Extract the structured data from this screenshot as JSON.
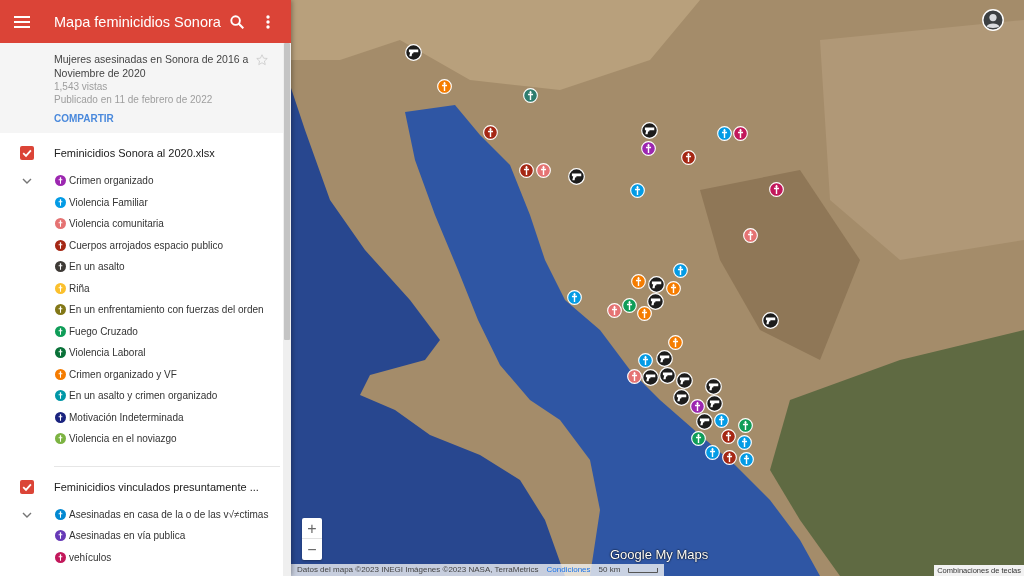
{
  "app_bar": {
    "title": "Mapa feminicidios Sonora"
  },
  "map_info": {
    "description": "Mujeres asesinadas en Sonora de 2016 a Noviembre de 2020",
    "views": "1,543 vistas",
    "published": "Publicado en 11 de febrero de 2022",
    "share_label": "COMPARTIR",
    "starred": false
  },
  "layers": [
    {
      "title": "Feminicidios Sonora al 2020.xlsx",
      "checked": true,
      "expanded": true,
      "items": [
        {
          "label": "Crimen organizado",
          "color": "#9c27b0"
        },
        {
          "label": "Violencia Familiar",
          "color": "#039be5"
        },
        {
          "label": "Violencia comunitaria",
          "color": "#e57373"
        },
        {
          "label": "Cuerpos arrojados espacio publico",
          "color": "#a52714"
        },
        {
          "label": "En un asalto",
          "color": "#3e3a36"
        },
        {
          "label": "Riña",
          "color": "#fbc02d"
        },
        {
          "label": "En un enfrentamiento con fuerzas del orden",
          "color": "#827717"
        },
        {
          "label": "Fuego Cruzado",
          "color": "#0f9d58"
        },
        {
          "label": "Violencia Laboral",
          "color": "#097138"
        },
        {
          "label": "Crimen organizado y VF",
          "color": "#f57c00"
        },
        {
          "label": "En un asalto y crimen organizado",
          "color": "#0097a7"
        },
        {
          "label": "Motivación Indeterminada",
          "color": "#1a237e"
        },
        {
          "label": "Violencia en el noviazgo",
          "color": "#7cb342"
        }
      ]
    },
    {
      "title": "Feminicidios vinculados presuntamente ...",
      "checked": true,
      "expanded": true,
      "items": [
        {
          "label": "Asesinadas en casa de la o de las v√≠ctimas",
          "color": "#0288d1"
        },
        {
          "label": "Asesinadas en vía publica",
          "color": "#673ab7"
        },
        {
          "label": "vehículos",
          "color": "#c2185b"
        }
      ]
    }
  ],
  "map": {
    "markers": [
      {
        "kind": "gun",
        "color": "#1c1c1c"
      },
      {
        "kind": "cross",
        "color": "#f57c00"
      },
      {
        "kind": "cross",
        "color": "#2e7d6f"
      },
      {
        "kind": "cross",
        "color": "#a52714"
      },
      {
        "kind": "cross",
        "color": "#a52714"
      },
      {
        "kind": "cross",
        "color": "#e57373"
      },
      {
        "kind": "gun",
        "color": "#1c1c1c"
      },
      {
        "kind": "gun",
        "color": "#1c1c1c"
      },
      {
        "kind": "cross",
        "color": "#9c27b0"
      },
      {
        "kind": "cross",
        "color": "#a52714"
      },
      {
        "kind": "cross",
        "color": "#039be5"
      },
      {
        "kind": "cross",
        "color": "#c2185b"
      },
      {
        "kind": "cross",
        "color": "#039be5"
      },
      {
        "kind": "cross",
        "color": "#c2185b"
      },
      {
        "kind": "cross",
        "color": "#e57373"
      },
      {
        "kind": "cross",
        "color": "#039be5"
      },
      {
        "kind": "cross",
        "color": "#f57c00"
      },
      {
        "kind": "cross",
        "color": "#f57c00"
      },
      {
        "kind": "gun",
        "color": "#1c1c1c"
      },
      {
        "kind": "gun",
        "color": "#1c1c1c"
      },
      {
        "kind": "cross",
        "color": "#039be5"
      },
      {
        "kind": "cross",
        "color": "#e57373"
      },
      {
        "kind": "cross",
        "color": "#0f9d58"
      },
      {
        "kind": "cross",
        "color": "#f57c00"
      },
      {
        "kind": "gun",
        "color": "#1c1c1c"
      },
      {
        "kind": "cross",
        "color": "#f57c00"
      },
      {
        "kind": "cross",
        "color": "#039be5"
      },
      {
        "kind": "gun",
        "color": "#1c1c1c"
      },
      {
        "kind": "cross",
        "color": "#e57373"
      },
      {
        "kind": "gun",
        "color": "#1c1c1c"
      },
      {
        "kind": "gun",
        "color": "#1c1c1c"
      },
      {
        "kind": "gun",
        "color": "#1c1c1c"
      },
      {
        "kind": "gun",
        "color": "#1c1c1c"
      },
      {
        "kind": "gun",
        "color": "#1c1c1c"
      },
      {
        "kind": "cross",
        "color": "#9c27b0"
      },
      {
        "kind": "gun",
        "color": "#1c1c1c"
      },
      {
        "kind": "gun",
        "color": "#1c1c1c"
      },
      {
        "kind": "cross",
        "color": "#039be5"
      },
      {
        "kind": "cross",
        "color": "#0f9d58"
      },
      {
        "kind": "cross",
        "color": "#0f9d58"
      },
      {
        "kind": "cross",
        "color": "#a52714"
      },
      {
        "kind": "cross",
        "color": "#039be5"
      },
      {
        "kind": "cross",
        "color": "#039be5"
      },
      {
        "kind": "cross",
        "color": "#a52714"
      },
      {
        "kind": "cross",
        "color": "#039be5"
      }
    ],
    "zoom_in_label": "+",
    "zoom_out_label": "−",
    "attribution": "Datos del mapa ©2023 INEGI Imágenes ©2023 NASA, TerraMetrics",
    "terms_link": "Condiciones",
    "scale": "50 km",
    "logo": "Google My Maps",
    "shortcuts": "Combinaciones de teclas"
  }
}
